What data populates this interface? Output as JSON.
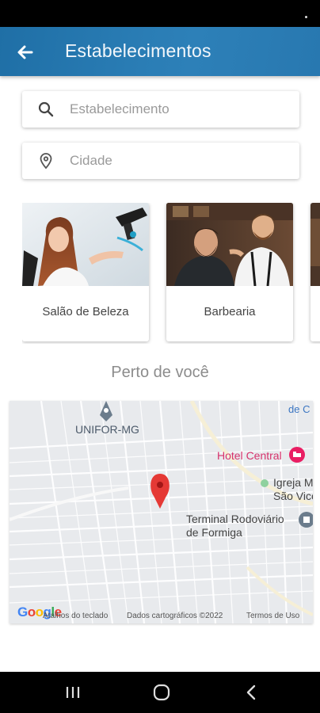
{
  "header": {
    "title": "Estabelecimentos",
    "back_icon": "arrow-left-icon"
  },
  "search": {
    "placeholder": "Estabelecimento",
    "icon": "search-icon"
  },
  "city": {
    "placeholder": "Cidade",
    "icon": "location-pin-icon"
  },
  "categories": [
    {
      "label": "Salão de Beleza"
    },
    {
      "label": "Barbearia"
    }
  ],
  "nearby": {
    "title": "Perto de você",
    "map": {
      "labels": {
        "unifor": "UNIFOR-MG",
        "hotel": "Hotel Central",
        "igreja_1": "Igreja M",
        "igreja_2": "São Vicent",
        "terminal_1": "Terminal Rodoviário",
        "terminal_2": "de Formiga",
        "edge": "de C"
      },
      "footer": {
        "shortcuts": "Atalhos do teclado",
        "copyright": "Dados cartográficos ©2022",
        "terms": "Termos de Uso"
      },
      "logo": "Google"
    }
  },
  "colors": {
    "app_bar": "#2a7db5",
    "marker": "#e53935",
    "hotel": "#d6336c"
  }
}
